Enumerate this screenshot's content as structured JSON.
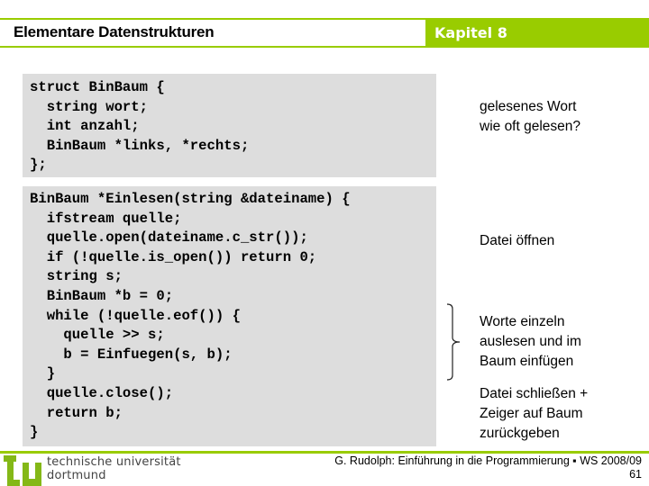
{
  "header": {
    "title": "Elementare Datenstrukturen",
    "chapter": "Kapitel 8",
    "accent_color": "#99cc00"
  },
  "code_blocks": [
    {
      "lines": [
        "struct BinBaum {",
        "  string wort;",
        "  int anzahl;",
        "  BinBaum *links, *rechts;",
        "};"
      ]
    },
    {
      "lines": [
        "BinBaum *Einlesen(string &dateiname) {",
        "  ifstream quelle;",
        "  quelle.open(dateiname.c_str());",
        "  if (!quelle.is_open()) return 0;",
        "  string s;",
        "  BinBaum *b = 0;",
        "  while (!quelle.eof()) {",
        "    quelle >> s;",
        "    b = Einfuegen(s, b);",
        "  }",
        "  quelle.close();",
        "  return b;",
        "}"
      ]
    }
  ],
  "annotations": [
    {
      "text": "gelesenes Wort\nwie oft gelesen?"
    },
    {
      "text": "Datei öffnen"
    },
    {
      "text": "Worte einzeln\nauslesen und im\nBaum einfügen"
    },
    {
      "text": "Datei schließen +\nZeiger auf Baum\nzurückgeben"
    }
  ],
  "footer": {
    "university_line1": "technische universität",
    "university_line2": "dortmund",
    "course": "G. Rudolph: Einführung in die Programmierung ▪ WS 2008/09",
    "page_number": "61"
  }
}
